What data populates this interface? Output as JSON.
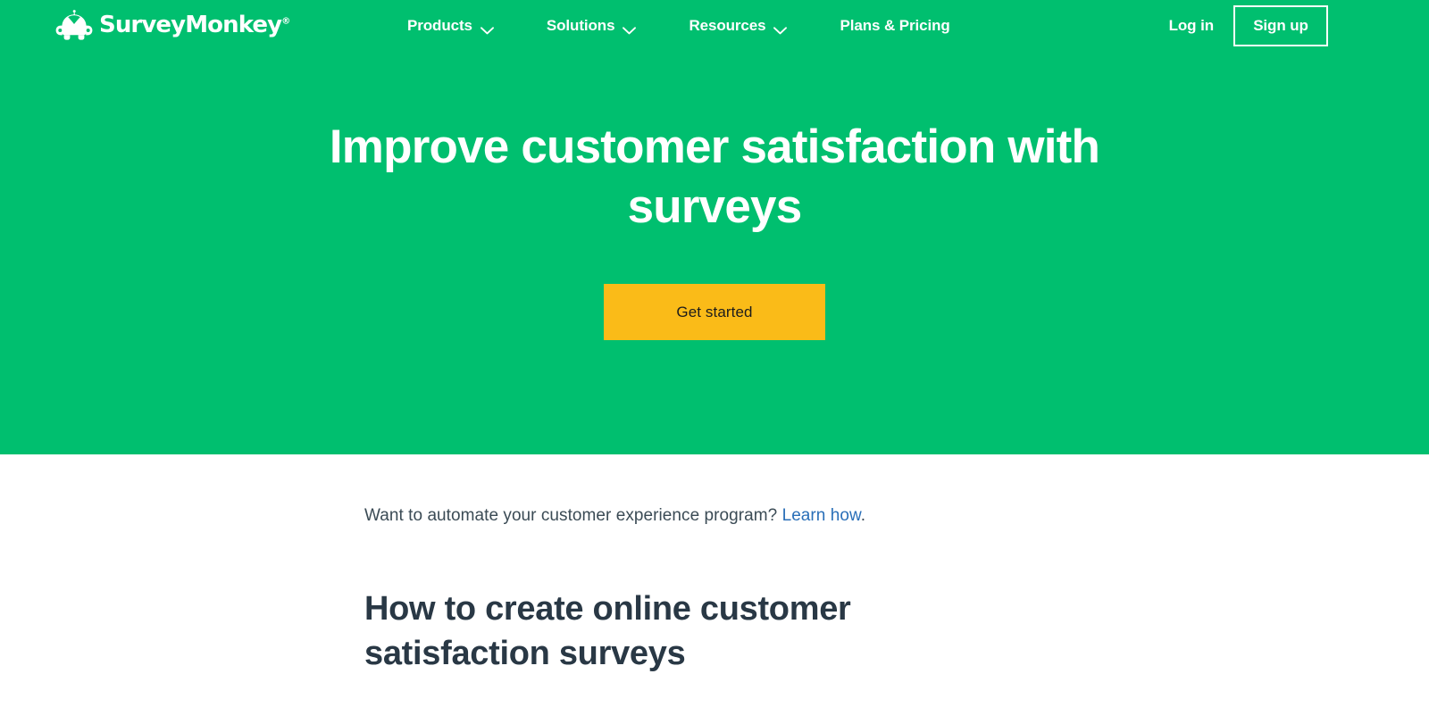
{
  "brand": {
    "name": "SurveyMonkey",
    "trademark": "®",
    "logo_icon": "surveymonkey-monkey-logo"
  },
  "nav": {
    "items": [
      {
        "label": "Products",
        "has_dropdown": true,
        "icon": "chevron-down-icon"
      },
      {
        "label": "Solutions",
        "has_dropdown": true,
        "icon": "chevron-down-icon"
      },
      {
        "label": "Resources",
        "has_dropdown": true,
        "icon": "chevron-down-icon"
      },
      {
        "label": "Plans & Pricing",
        "has_dropdown": false,
        "icon": ""
      }
    ],
    "login_label": "Log in",
    "signup_label": "Sign up"
  },
  "hero": {
    "title": "Improve customer satisfaction with surveys",
    "cta_label": "Get started",
    "background_color": "#00bf6f",
    "cta_color": "#fabb18"
  },
  "content": {
    "automate_text_before": "Want to automate your customer experience program? ",
    "automate_link_label": "Learn how",
    "automate_text_after": ".",
    "link_color": "#2a6fb8",
    "section_title": "How to create online customer satisfaction surveys"
  }
}
